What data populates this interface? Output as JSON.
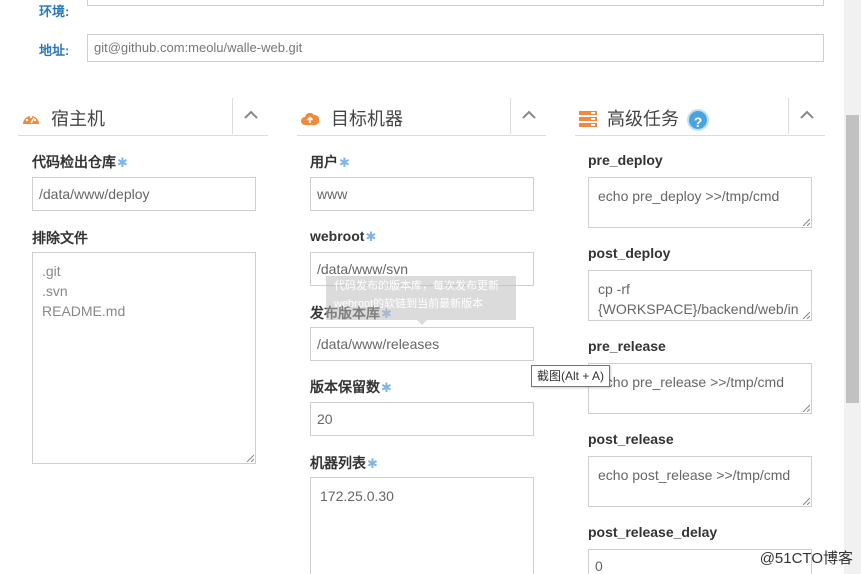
{
  "top": {
    "env_label": "环境:",
    "address_label": "地址:",
    "address_value": "git@github.com:meolu/walle-web.git"
  },
  "host": {
    "title": "宿主机",
    "repo_label": "代码检出仓库",
    "repo_value": "/data/www/deploy",
    "exclude_label": "排除文件",
    "exclude_lines": [
      ".git",
      ".svn",
      "README.md"
    ]
  },
  "target": {
    "title": "目标机器",
    "user_label": "用户",
    "user_value": "www",
    "webroot_label": "webroot",
    "webroot_value": "/data/www/svn",
    "release_label": "发布版本库",
    "release_value": "/data/www/releases",
    "keep_label": "版本保留数",
    "keep_value": "20",
    "hosts_label": "机器列表",
    "hosts_value": "172.25.0.30"
  },
  "advanced": {
    "title": "高级任务",
    "help_glyph": "?",
    "pre_deploy_label": "pre_deploy",
    "pre_deploy_value": "echo pre_deploy >>/tmp/cmd",
    "post_deploy_label": "post_deploy",
    "post_deploy_line1": "cp -rf",
    "post_deploy_line2": "{WORKSPACE}/backend/web/in",
    "pre_release_label": "pre_release",
    "pre_release_value": "echo pre_release >>/tmp/cmd",
    "post_release_label": "post_release",
    "post_release_value": "echo post_release >>/tmp/cmd",
    "post_release_delay_label": "post_release_delay",
    "post_release_delay_value": "0"
  },
  "required_mark": "✱",
  "tooltip": {
    "line1": "代码发布的版本库，每次发布更新",
    "line2": "webroot的软链到当前最新版本"
  },
  "screenshot_hint": "截图(Alt + A)",
  "watermark": "@51CTO博客",
  "colors": {
    "accent_orange": "#f08a3c",
    "label_blue": "#2a78b8",
    "required_blue": "#7fb6e8",
    "help_blue": "#4aa3df"
  },
  "icons": {
    "host": "dashboard-gauge-icon",
    "target": "cloud-upload-icon",
    "advanced": "server-tasks-icon",
    "collapse": "chevron-up-icon"
  }
}
